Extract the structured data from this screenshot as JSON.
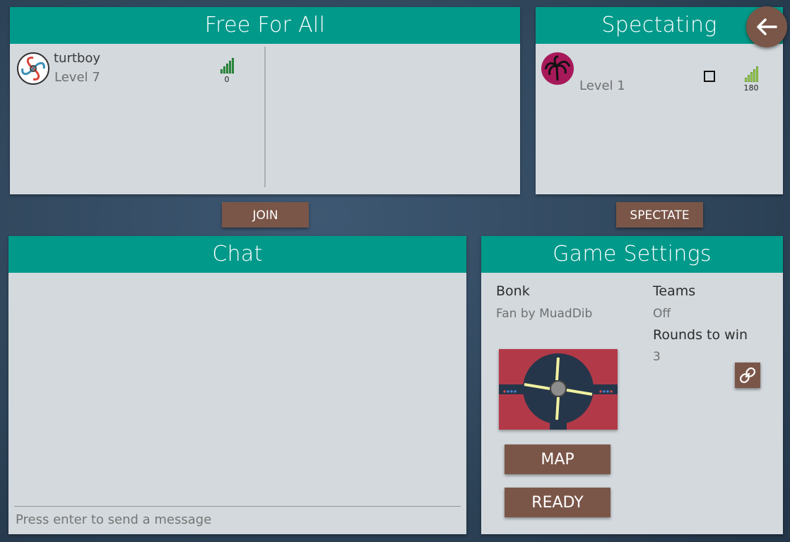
{
  "ffa": {
    "title": "Free For All",
    "players": [
      {
        "name": "turtboy",
        "level": "Level 7",
        "ping": "0"
      }
    ],
    "join_label": "JOIN"
  },
  "spectating": {
    "title": "Spectating",
    "players": [
      {
        "name": "",
        "level": "Level 1",
        "ping": "180"
      }
    ],
    "spectate_label": "SPECTATE"
  },
  "chat": {
    "title": "Chat",
    "placeholder": "Press enter to send a message"
  },
  "settings": {
    "title": "Game Settings",
    "mode": "Bonk",
    "map_name": "Fan by MuadDib",
    "teams_label": "Teams",
    "teams_value": "Off",
    "rounds_label": "Rounds to win",
    "rounds_value": "3",
    "map_button": "MAP",
    "ready_button": "READY"
  },
  "icons": {
    "back": "arrow-left-icon",
    "link": "link-icon",
    "checkbox": "checkbox-icon",
    "ping": "signal-bars-icon"
  },
  "colors": {
    "header": "#00998a",
    "panel": "#d3d9dd",
    "button": "#7a5648",
    "background": "#2e4458",
    "map_red": "#b23a48",
    "map_dark": "#26364a"
  }
}
